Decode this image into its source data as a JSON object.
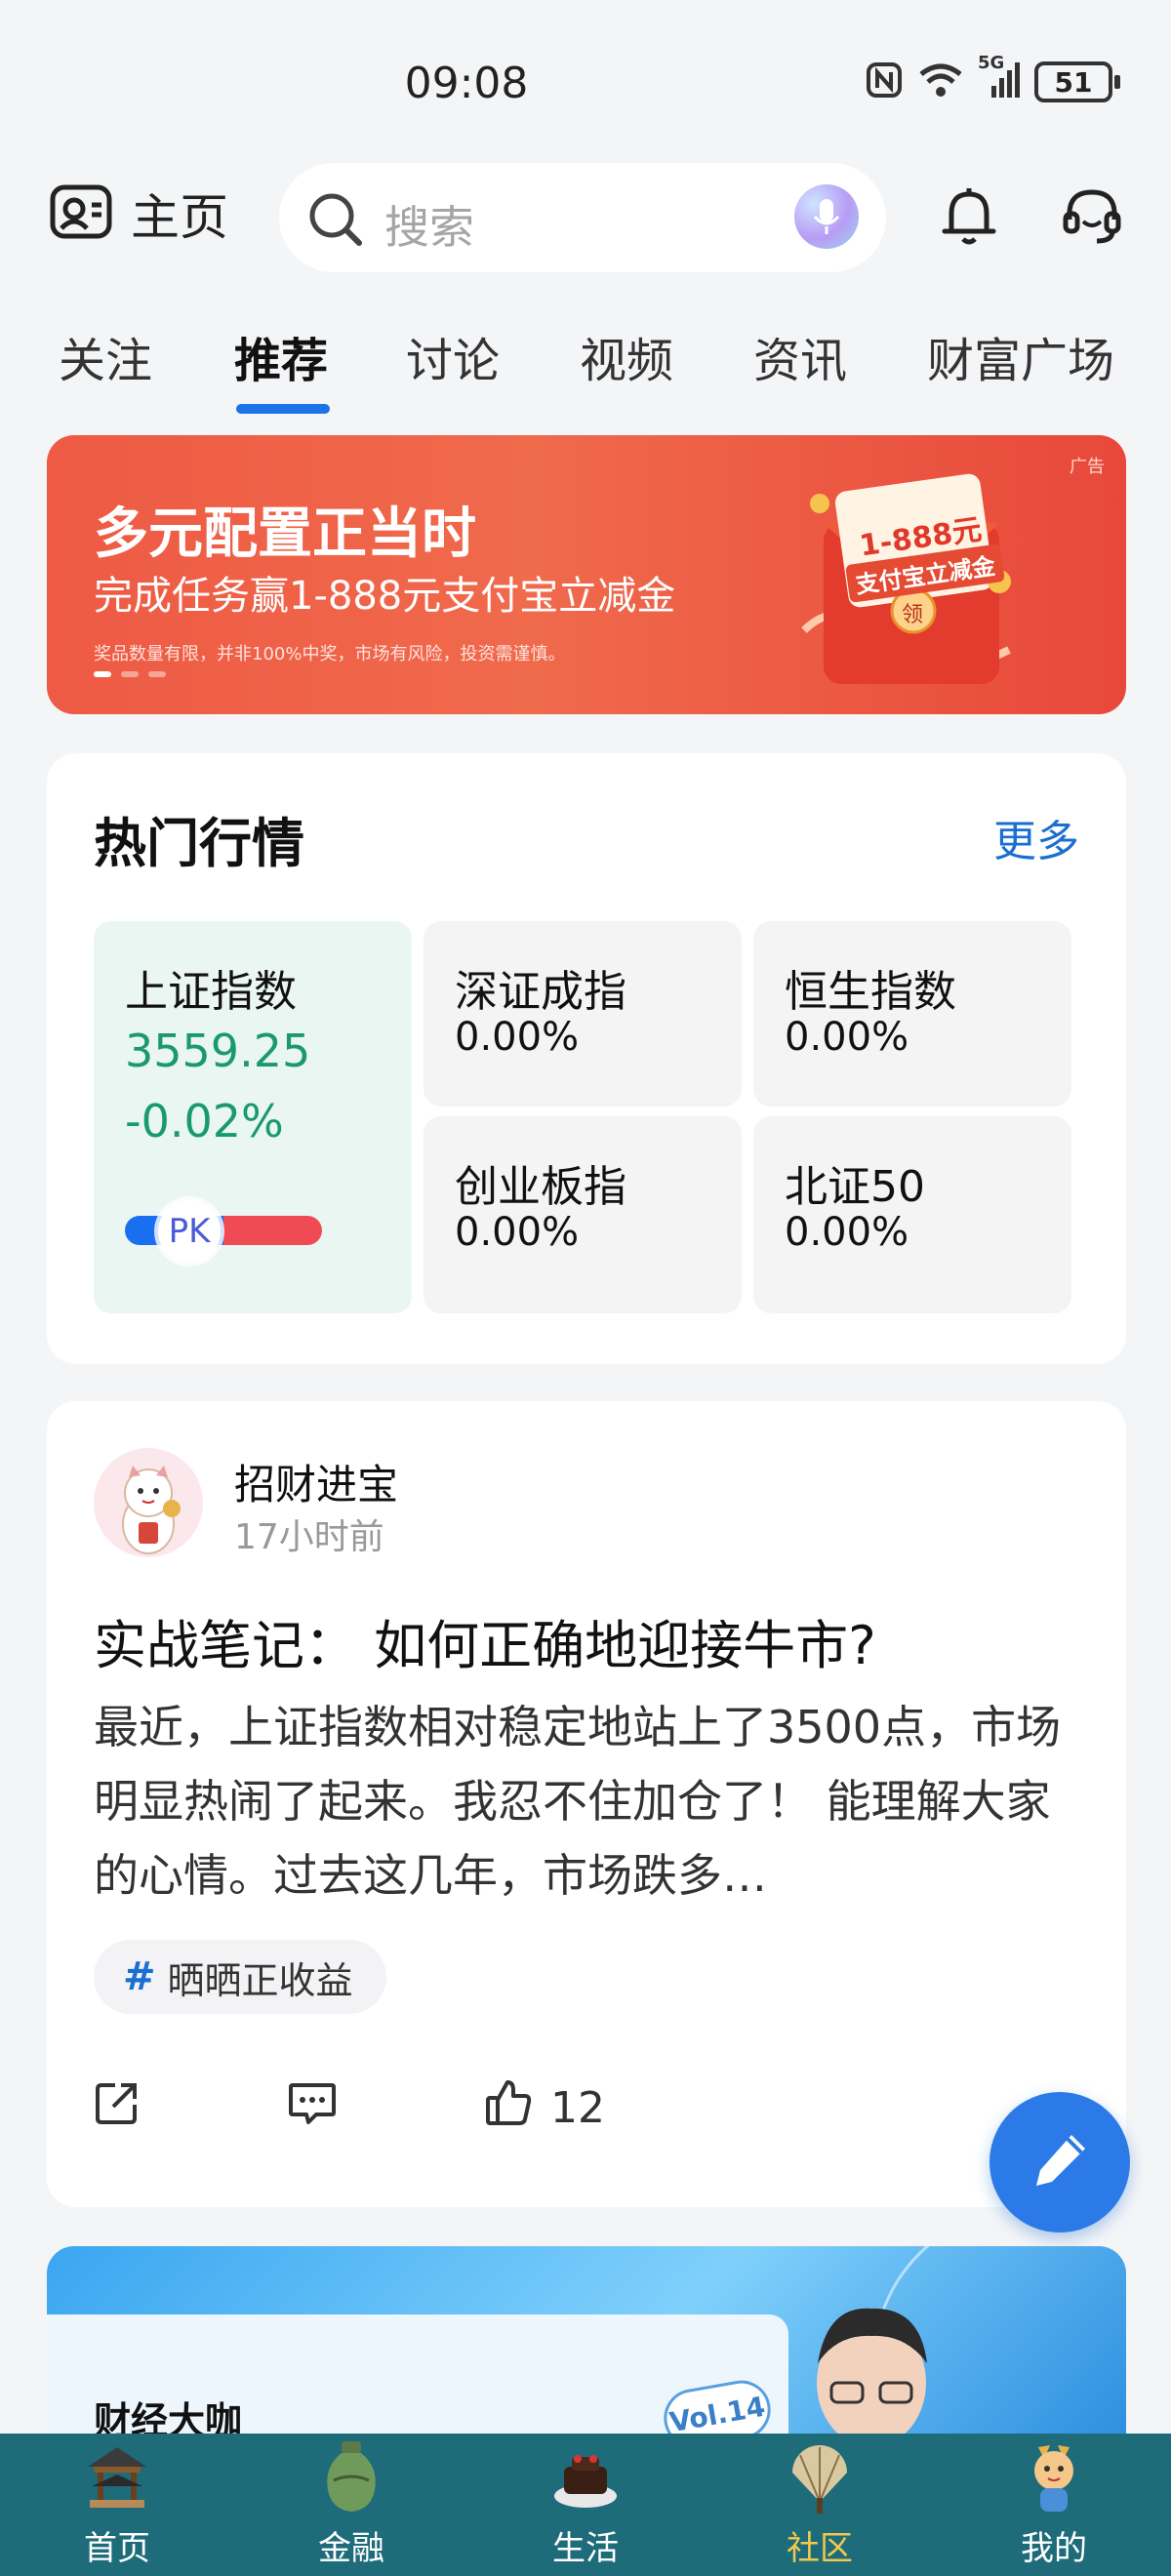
{
  "status_bar": {
    "time": "09:08",
    "network": "5G",
    "battery": "51"
  },
  "header": {
    "home_label": "主页",
    "search_placeholder": "搜索"
  },
  "tabs": [
    {
      "label": "关注",
      "active": false
    },
    {
      "label": "推荐",
      "active": true
    },
    {
      "label": "讨论",
      "active": false
    },
    {
      "label": "视频",
      "active": false
    },
    {
      "label": "资讯",
      "active": false
    },
    {
      "label": "财富广场",
      "active": false
    }
  ],
  "banner": {
    "title": "多元配置正当时",
    "subtitle": "完成任务赢1-888元支付宝立减金",
    "note": "奖品数量有限，并非100%中奖，市场有风险，投资需谨慎。",
    "ad_label": "广告",
    "packet_amount": "1-888元",
    "packet_text": "支付宝立减金",
    "packet_button": "领"
  },
  "market": {
    "title": "热门行情",
    "more": "更多",
    "indices": [
      {
        "name": "上证指数",
        "value": "3559.25",
        "change": "-0.02%"
      },
      {
        "name": "深证成指",
        "value": "0.00%"
      },
      {
        "name": "恒生指数",
        "value": "0.00%"
      },
      {
        "name": "创业板指",
        "value": "0.00%"
      },
      {
        "name": "北证50",
        "value": "0.00%"
      }
    ],
    "pk_label": "PK",
    "colors": {
      "down": "#1a9a6b",
      "pk_left": "#1a6ff0",
      "pk_right": "#f04b55"
    }
  },
  "post": {
    "author": "招财进宝",
    "time": "17小时前",
    "title": "实战笔记： 如何正确地迎接牛市?",
    "body": "最近，上证指数相对稳定地站上了3500点，市场明显热闹了起来。我忍不住加仓了！ 能理解大家的心情。过去这几年，市场跌多…",
    "tag_symbol": "#",
    "tag": "晒晒正收益",
    "like_count": "12"
  },
  "video_banner": {
    "title": "财经大咖",
    "vol": "Vol.14"
  },
  "bottom_nav": [
    {
      "label": "首页",
      "icon": "pavilion-icon",
      "active": false
    },
    {
      "label": "金融",
      "icon": "vase-icon",
      "active": false
    },
    {
      "label": "生活",
      "icon": "cake-icon",
      "active": false
    },
    {
      "label": "社区",
      "icon": "fan-icon",
      "active": true
    },
    {
      "label": "我的",
      "icon": "mascot-icon",
      "active": false
    }
  ],
  "accent_color": "#1a73e8"
}
